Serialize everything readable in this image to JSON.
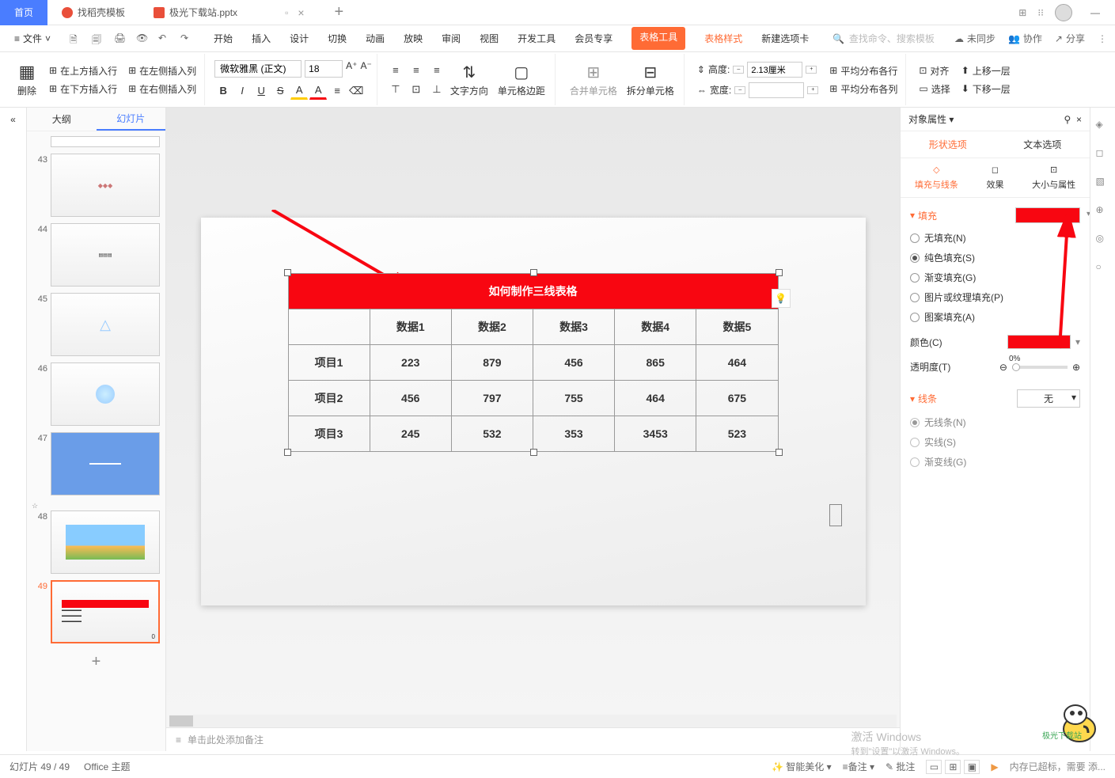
{
  "titlebar": {
    "home": "首页",
    "template": "找稻壳模板",
    "doc": "极光下载站.pptx"
  },
  "menubar": {
    "file": "文件",
    "tabs": [
      "开始",
      "插入",
      "设计",
      "切换",
      "动画",
      "放映",
      "审阅",
      "视图",
      "开发工具",
      "会员专享"
    ],
    "table_tools": "表格工具",
    "table_style": "表格样式",
    "new_tab": "新建选项卡",
    "search_placeholder": "查找命令、搜索模板",
    "unsync": "未同步",
    "coop": "协作",
    "share": "分享"
  },
  "ribbon": {
    "delete": "删除",
    "ins_above": "在上方插入行",
    "ins_left": "在左侧插入列",
    "ins_below": "在下方插入行",
    "ins_right": "在右侧插入列",
    "font_name": "微软雅黑 (正文)",
    "font_size": "18",
    "text_dir": "文字方向",
    "cell_margin": "单元格边距",
    "merge": "合并单元格",
    "split": "拆分单元格",
    "height": "高度:",
    "width": "宽度:",
    "height_val": "2.13厘米",
    "dist_rows": "平均分布各行",
    "dist_cols": "平均分布各列",
    "align": "对齐",
    "select": "选择",
    "bring_fwd": "上移一层",
    "send_back": "下移一层"
  },
  "left_panel": {
    "outline": "大纲",
    "slides": "幻灯片",
    "nums": [
      "43",
      "44",
      "45",
      "46",
      "47",
      "48",
      "49"
    ]
  },
  "slide": {
    "title": "如何制作三线表格",
    "headers": [
      "",
      "数据1",
      "数据2",
      "数据3",
      "数据4",
      "数据5"
    ],
    "rows": [
      {
        "label": "项目1",
        "cells": [
          "223",
          "879",
          "456",
          "865",
          "464"
        ]
      },
      {
        "label": "项目2",
        "cells": [
          "456",
          "797",
          "755",
          "464",
          "675"
        ]
      },
      {
        "label": "项目3",
        "cells": [
          "245",
          "532",
          "353",
          "3453",
          "523"
        ]
      }
    ]
  },
  "chart_data": {
    "type": "table",
    "title": "如何制作三线表格",
    "columns": [
      "数据1",
      "数据2",
      "数据3",
      "数据4",
      "数据5"
    ],
    "rows": [
      "项目1",
      "项目2",
      "项目3"
    ],
    "values": [
      [
        223,
        879,
        456,
        865,
        464
      ],
      [
        456,
        797,
        755,
        464,
        675
      ],
      [
        245,
        532,
        353,
        3453,
        523
      ]
    ]
  },
  "notes": {
    "placeholder": "单击此处添加备注"
  },
  "right_panel": {
    "title": "对象属性",
    "shape_tab": "形状选项",
    "text_tab": "文本选项",
    "fill_line": "填充与线条",
    "effect": "效果",
    "size_prop": "大小与属性",
    "fill": "填充",
    "no_fill": "无填充(N)",
    "solid_fill": "纯色填充(S)",
    "gradient_fill": "渐变填充(G)",
    "picture_fill": "图片或纹理填充(P)",
    "pattern_fill": "图案填充(A)",
    "color": "颜色(C)",
    "opacity": "透明度(T)",
    "opacity_val": "0%",
    "line": "线条",
    "line_val": "无",
    "no_line": "无线条(N)",
    "solid_line": "实线(S)",
    "gradient_line": "渐变线(G)"
  },
  "status": {
    "slide_pos": "幻灯片 49 / 49",
    "theme": "Office 主题",
    "beautify": "智能美化",
    "notes_btn": "备注",
    "comment": "批注",
    "activate": "激活 Windows",
    "activate_sub": "转到\"设置\"以激活 Windows。",
    "mem": "内存已超标，需要 添..."
  }
}
